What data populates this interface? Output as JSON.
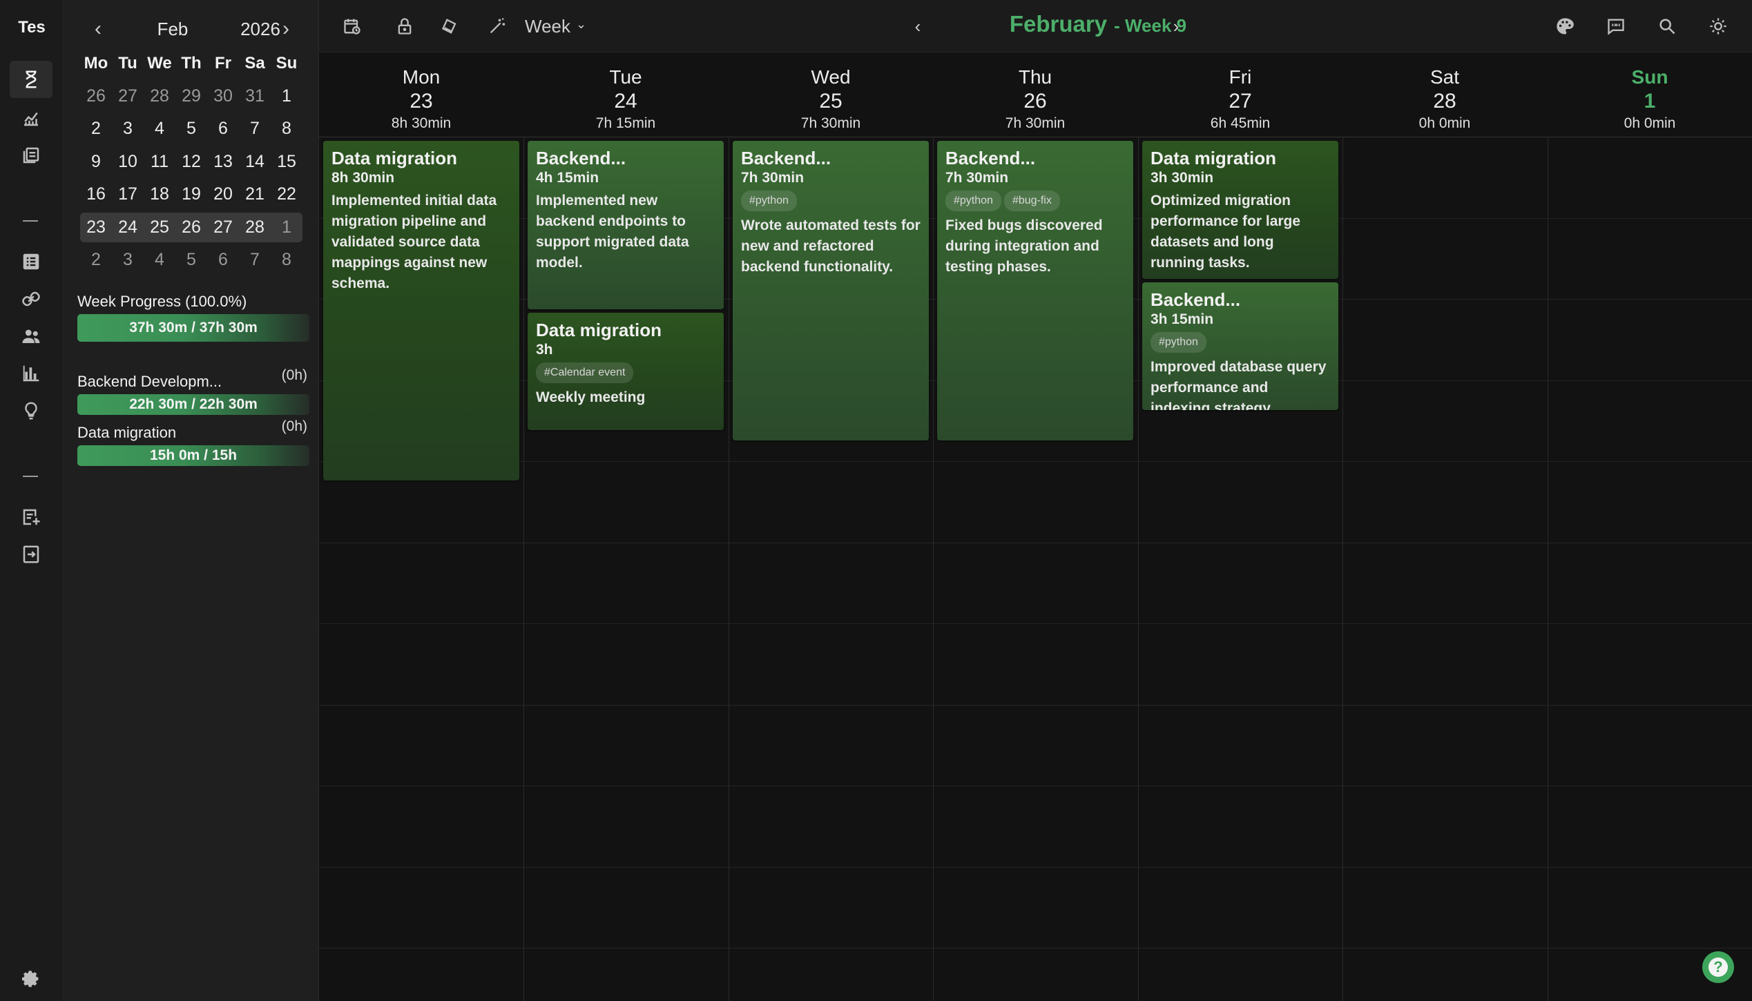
{
  "rail": {
    "brand": "Tes"
  },
  "mini_calendar": {
    "month": "Feb",
    "year": "2026",
    "prev_glyph": "‹",
    "next_glyph": "›",
    "weekdays": [
      "Mo",
      "Tu",
      "We",
      "Th",
      "Fr",
      "Sa",
      "Su"
    ],
    "weeks": [
      {
        "days": [
          "26",
          "27",
          "28",
          "29",
          "30",
          "31",
          "1"
        ],
        "muted": [
          true,
          true,
          true,
          true,
          true,
          true,
          false
        ],
        "selected": false
      },
      {
        "days": [
          "2",
          "3",
          "4",
          "5",
          "6",
          "7",
          "8"
        ],
        "muted": [
          false,
          false,
          false,
          false,
          false,
          false,
          false
        ],
        "selected": false
      },
      {
        "days": [
          "9",
          "10",
          "11",
          "12",
          "13",
          "14",
          "15"
        ],
        "muted": [
          false,
          false,
          false,
          false,
          false,
          false,
          false
        ],
        "selected": false
      },
      {
        "days": [
          "16",
          "17",
          "18",
          "19",
          "20",
          "21",
          "22"
        ],
        "muted": [
          false,
          false,
          false,
          false,
          false,
          false,
          false
        ],
        "selected": false
      },
      {
        "days": [
          "23",
          "24",
          "25",
          "26",
          "27",
          "28",
          "1"
        ],
        "muted": [
          false,
          false,
          false,
          false,
          false,
          false,
          true
        ],
        "selected": true
      },
      {
        "days": [
          "2",
          "3",
          "4",
          "5",
          "6",
          "7",
          "8"
        ],
        "muted": [
          true,
          true,
          true,
          true,
          true,
          true,
          true
        ],
        "selected": false
      }
    ]
  },
  "week_progress": {
    "title": "Week Progress (100.0%)",
    "value": "37h 30m / 37h 30m",
    "fraction": 1.0
  },
  "project_progress": [
    {
      "name": "Backend Developm...",
      "pct": "(0h)",
      "value": "22h 30m / 22h 30m",
      "fraction": 1.0
    },
    {
      "name": "Data migration",
      "pct": "(0h)",
      "value": "15h 0m / 15h",
      "fraction": 1.0
    }
  ],
  "toolbar": {
    "view_label": "Week",
    "view_chevron": "⌄",
    "title_month": "February",
    "title_week": "- Week 9",
    "prev_glyph": "‹",
    "next_glyph": "›"
  },
  "days": [
    {
      "name": "Mon",
      "date": "23",
      "total": "8h 30min",
      "today": false
    },
    {
      "name": "Tue",
      "date": "24",
      "total": "7h 15min",
      "today": false
    },
    {
      "name": "Wed",
      "date": "25",
      "total": "7h 30min",
      "today": false
    },
    {
      "name": "Thu",
      "date": "26",
      "total": "7h 30min",
      "today": false
    },
    {
      "name": "Fri",
      "date": "27",
      "total": "6h 45min",
      "today": false
    },
    {
      "name": "Sat",
      "date": "28",
      "total": "0h 0min",
      "today": false
    },
    {
      "name": "Sun",
      "date": "1",
      "total": "0h 0min",
      "today": true
    }
  ],
  "events": [
    {
      "day": 0,
      "start": 0.0,
      "hours": 8.5,
      "kind": "dm",
      "title": "Data migration",
      "duration": "8h 30min",
      "tags": [],
      "desc": "Implemented initial data migration pipeline and validated source data mappings against new schema."
    },
    {
      "day": 1,
      "start": 0.0,
      "hours": 4.25,
      "kind": "be",
      "title": "Backend...",
      "duration": "4h 15min",
      "tags": [],
      "desc": "Implemented new backend endpoints to support migrated data model."
    },
    {
      "day": 1,
      "start": 4.25,
      "hours": 3.0,
      "kind": "dm",
      "title": "Data migration",
      "duration": "3h",
      "tags": [
        "#Calendar event"
      ],
      "desc": "Weekly meeting"
    },
    {
      "day": 2,
      "start": 0.0,
      "hours": 7.5,
      "kind": "be",
      "title": "Backend...",
      "duration": "7h 30min",
      "tags": [
        "#python"
      ],
      "desc": "Wrote automated tests for new and refactored backend functionality."
    },
    {
      "day": 3,
      "start": 0.0,
      "hours": 7.5,
      "kind": "be",
      "title": "Backend...",
      "duration": "7h 30min",
      "tags": [
        "#python",
        "#bug-fix"
      ],
      "desc": "Fixed bugs discovered during integration and testing phases."
    },
    {
      "day": 4,
      "start": 0.0,
      "hours": 3.5,
      "kind": "dm",
      "title": "Data migration",
      "duration": "3h 30min",
      "tags": [],
      "desc": "Optimized migration performance for large datasets and long running tasks."
    },
    {
      "day": 4,
      "start": 3.5,
      "hours": 3.25,
      "kind": "be",
      "title": "Backend...",
      "duration": "3h 15min",
      "tags": [
        "#python"
      ],
      "desc": "Improved database query performance and indexing strategy."
    }
  ],
  "colors": {
    "accent": "#4caf6a",
    "data_migration": "#2d5520",
    "backend": "#3a6a33"
  },
  "help": {
    "glyph": "?"
  }
}
